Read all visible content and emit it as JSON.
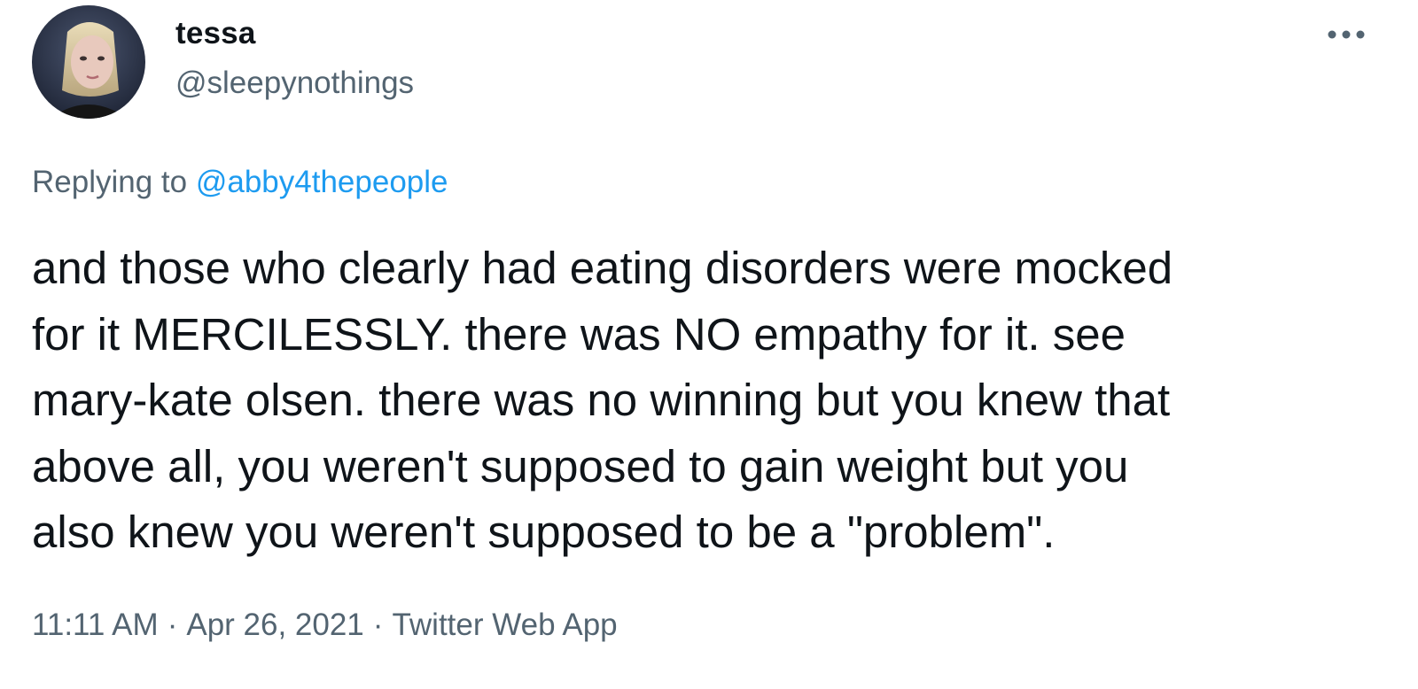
{
  "author": {
    "display_name": "tessa",
    "handle": "@sleepynothings",
    "avatar_icon": "user-avatar-photo"
  },
  "more_icon": "more-horizontal-icon",
  "reply": {
    "prefix": "Replying to",
    "mention": "@abby4thepeople"
  },
  "tweet_text": {
    "lines": [
      "and those who clearly had eating disorders were mocked",
      "for it MERCILESSLY. there was NO empathy for it. see",
      "mary-kate olsen. there was no winning but you knew that",
      "above all, you weren't supposed to gain weight but you",
      "also knew you weren't supposed to be a \"problem\"."
    ]
  },
  "meta": {
    "time": "11:11 AM",
    "separator": "·",
    "date": "Apr 26, 2021",
    "source": "Twitter Web App"
  },
  "colors": {
    "text_primary": "#0f1419",
    "text_secondary": "#536471",
    "link": "#1d9bf0",
    "background": "#ffffff"
  }
}
